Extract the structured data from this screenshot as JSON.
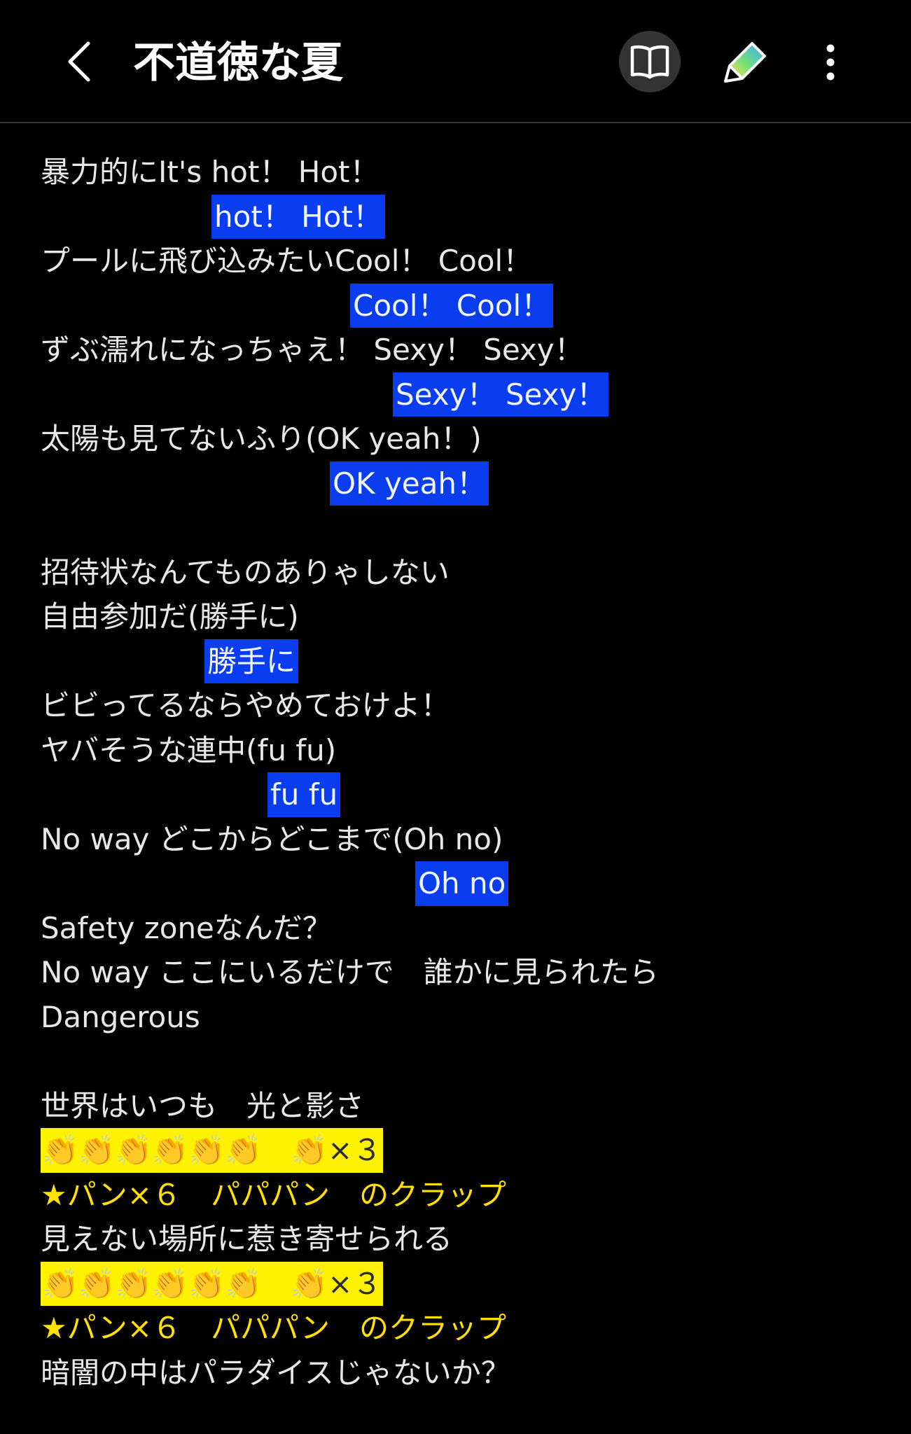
{
  "header": {
    "title": "不道徳な夏"
  },
  "lyrics": {
    "l1": "暴力的にIt's hot！ Hot！",
    "l2": "hot！ Hot！",
    "l3": "プールに飛び込みたいCool！ Cool！",
    "l4": "Cool！ Cool！",
    "l5": "ずぶ濡れになっちゃえ！ Sexy！ Sexy！",
    "l6": "Sexy！ Sexy！",
    "l7": "太陽も見てないふり(OK yeah！)",
    "l8": "OK yeah！",
    "l10": "招待状なんてものありゃしない",
    "l11": "自由参加だ(勝手に)",
    "l12": "勝手に",
    "l13": "ビビってるならやめておけよ！",
    "l14": "ヤバそうな連中(fu fu)",
    "l15": "fu fu",
    "l16": "No way どこからどこまで(Oh no)",
    "l17": "Oh no",
    "l18": "Safety zoneなんだ？",
    "l19": "No way ここにいるだけで　誰かに見られたら",
    "l20": "Dangerous",
    "l22": "世界はいつも　光と影さ",
    "l23": "👏👏👏👏👏👏　👏×３",
    "l24": "★パン×６　パパパン　のクラップ",
    "l25": "見えない場所に惹き寄せられる",
    "l26": "👏👏👏👏👏👏　👏×３",
    "l27": "★パン×６　パパパン　のクラップ",
    "l28": "暗闇の中はパラダイスじゃないか？"
  },
  "colors": {
    "background": "#000000",
    "blue_highlight": "#0a3df0",
    "yellow_highlight": "#fff200",
    "yellow_text": "#ffe000"
  },
  "icons": [
    "back-arrow-icon",
    "reader-mode-icon",
    "pen-icon",
    "more-options-icon"
  ]
}
